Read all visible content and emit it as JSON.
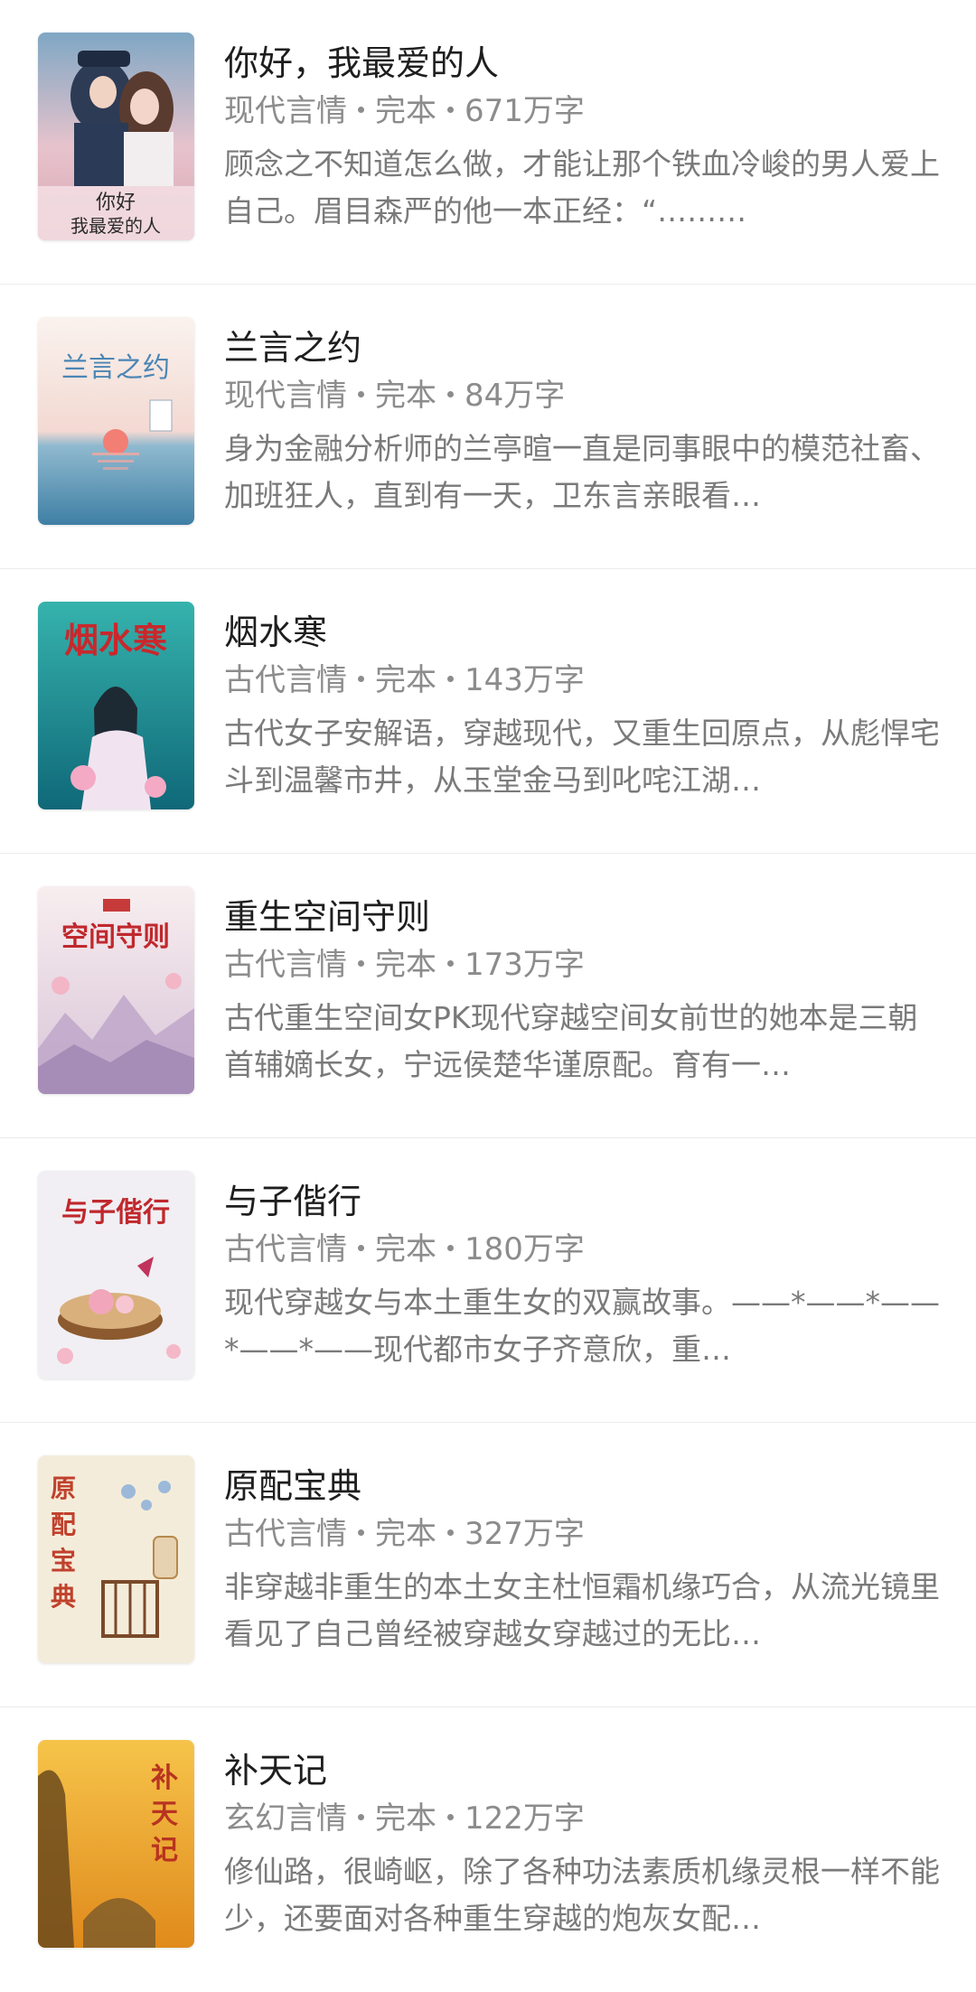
{
  "books": [
    {
      "title": "你好，我最爱的人",
      "category": "现代言情",
      "status": "完本",
      "word_count": "671万字",
      "description": "顾念之不知道怎么做，才能让那个铁血冷峻的男人爱上自己。眉目森严的他一本正经：“………",
      "cover": {
        "icon": "book-cover-image",
        "text": "你好 我最爱的人",
        "colors": [
          "#d9a7b3",
          "#3a4d6b"
        ]
      }
    },
    {
      "title": "兰言之约",
      "category": "现代言情",
      "status": "完本",
      "word_count": "84万字",
      "description": "身为金融分析师的兰亭暄一直是同事眼中的模范社畜、加班狂人，直到有一天，卫东言亲眼看…",
      "cover": {
        "icon": "book-cover-image",
        "text": "兰言之约",
        "colors": [
          "#f6ece6",
          "#4f8fb0"
        ]
      }
    },
    {
      "title": "烟水寒",
      "category": "古代言情",
      "status": "完本",
      "word_count": "143万字",
      "description": "古代女子安解语，穿越现代，又重生回原点，从彪悍宅斗到温馨市井，从玉堂金马到叱咤江湖…",
      "cover": {
        "icon": "book-cover-image",
        "text": "烟水寒",
        "colors": [
          "#2ea7a3",
          "#0f6b78"
        ]
      }
    },
    {
      "title": "重生空间守则",
      "category": "古代言情",
      "status": "完本",
      "word_count": "173万字",
      "description": "古代重生空间女PK现代穿越空间女前世的她本是三朝首辅嫡长女，宁远侯楚华谨原配。育有一…",
      "cover": {
        "icon": "book-cover-image",
        "text": "空间守则",
        "colors": [
          "#f5e9ea",
          "#b9a3c4"
        ]
      }
    },
    {
      "title": "与子偕行",
      "category": "古代言情",
      "status": "完本",
      "word_count": "180万字",
      "description": "现代穿越女与本土重生女的双赢故事。——*——*——*——*——现代都市女子齐意欣，重…",
      "cover": {
        "icon": "book-cover-image",
        "text": "与子偕行",
        "colors": [
          "#f1f0f3",
          "#c98f5c"
        ]
      }
    },
    {
      "title": "原配宝典",
      "category": "古代言情",
      "status": "完本",
      "word_count": "327万字",
      "description": "非穿越非重生的本土女主杜恒霜机缘巧合，从流光镜里看见了自己曾经被穿越女穿越过的无比…",
      "cover": {
        "icon": "book-cover-image",
        "text": "原配宝典",
        "colors": [
          "#f4eddc",
          "#c35a3c"
        ]
      }
    },
    {
      "title": "补天记",
      "category": "玄幻言情",
      "status": "完本",
      "word_count": "122万字",
      "description": "修仙路，很崎岖，除了各种功法素质机缘灵根一样不能少，还要面对各种重生穿越的炮灰女配…",
      "cover": {
        "icon": "book-cover-image",
        "text": "补天记",
        "colors": [
          "#f0b52e",
          "#6b4a1c"
        ]
      }
    }
  ]
}
